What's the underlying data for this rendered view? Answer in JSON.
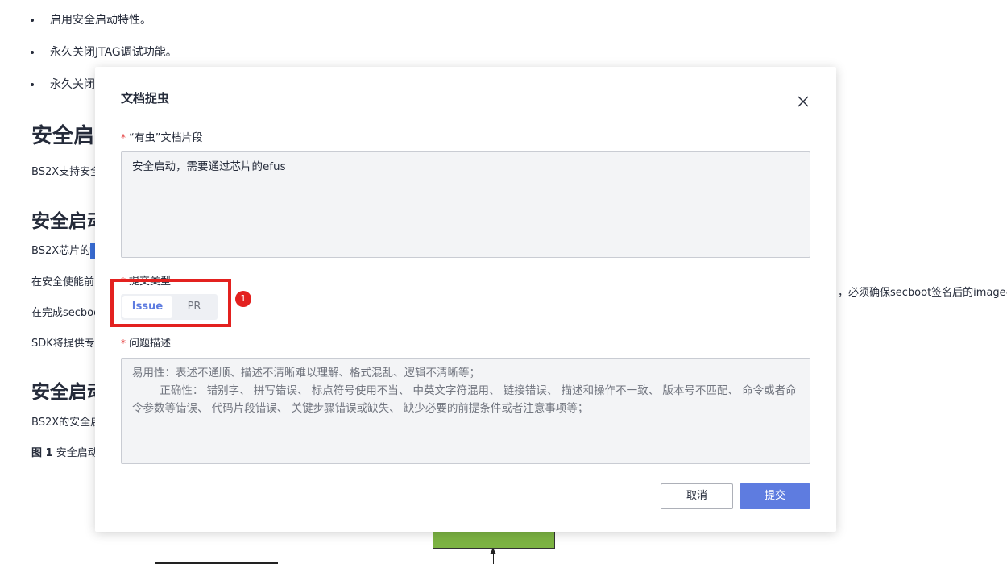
{
  "background_doc": {
    "bullets": [
      "启用安全启动特性。",
      "永久关闭JTAG调试功能。",
      "永久关闭"
    ],
    "heading_1": "安全启",
    "para_1": "BS2X支持安全",
    "heading_2": "安全启动",
    "para_2": "BS2X芯片的",
    "para_3_left": "在安全使能前",
    "para_3_right": "，必须确保secboot签名后的image不",
    "para_4": "在完成secboo",
    "para_5": "SDK将提供专",
    "heading_3": "安全启动",
    "para_6": "BS2X的安全启",
    "figure_caption": {
      "num": "图 1",
      "text": " 安全启动"
    }
  },
  "modal": {
    "title": "文档捉虫",
    "fragment_label": "“有虫”文档片段",
    "fragment_value": "安全启动，需要通过芯片的efus",
    "submit_type_label": "提交类型",
    "submit_type_options": [
      "Issue",
      "PR"
    ],
    "submit_type_selected": "Issue",
    "desc_label": "问题描述",
    "desc_placeholder": "易用性：表述不通顺、描述不清晰难以理解、格式混乱、逻辑不清晰等；\n        正确性： 错别字、 拼写错误、 标点符号使用不当、 中英文字符混用、 链接错误、 描述和操作不一致、 版本号不匹配、 命令或者命令参数等错误、 代码片段错误、 关键步骤错误或缺失、 缺少必要的前提条件或者注意事项等；",
    "required_mark": "*",
    "cancel_label": "取消",
    "submit_label": "提交"
  },
  "annotation": {
    "badge": "1",
    "color": "#e3211f"
  },
  "colors": {
    "primary": "#5e7ce0",
    "text": "#252b3a",
    "placeholder": "#71757f",
    "textarea_bg": "#f3f4f6",
    "flow_box": "#7cb342"
  }
}
